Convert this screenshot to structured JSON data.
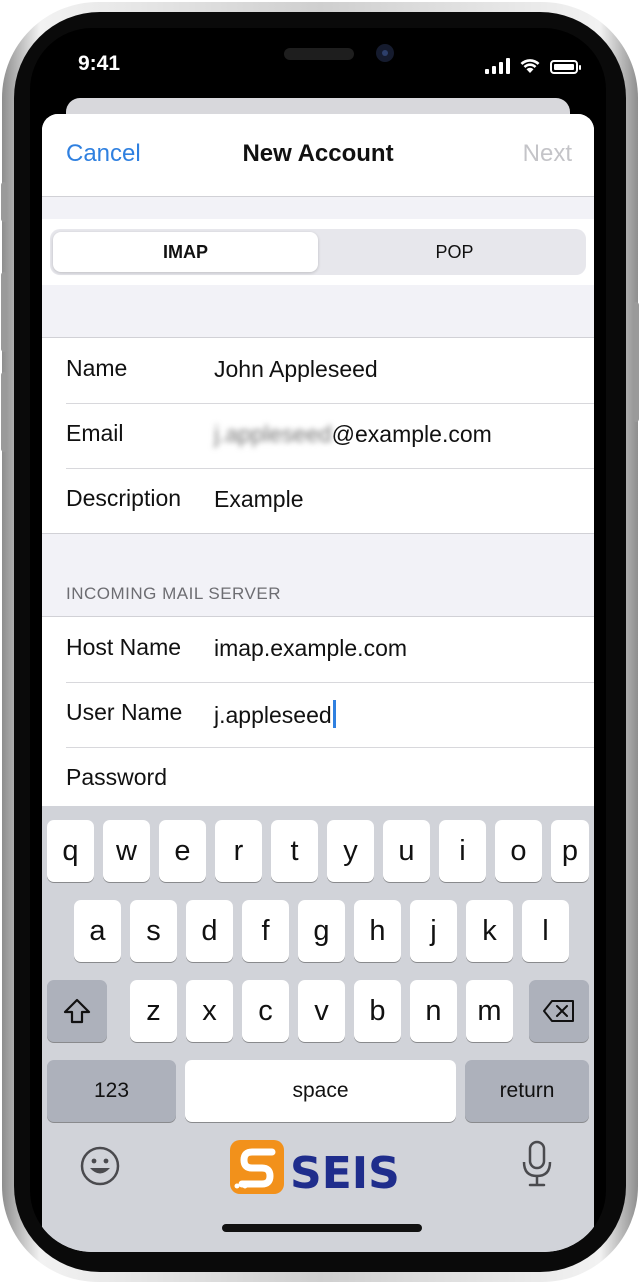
{
  "status_bar": {
    "time": "9:41"
  },
  "nav": {
    "cancel": "Cancel",
    "title": "New Account",
    "next": "Next"
  },
  "segment": {
    "options": [
      "IMAP",
      "POP"
    ],
    "selected": "IMAP"
  },
  "account": {
    "rows": [
      {
        "label": "Name",
        "value": "John Appleseed"
      },
      {
        "label": "Email",
        "value_blurred": "j.appleseed",
        "value_suffix": "@example.com"
      },
      {
        "label": "Description",
        "value": "Example"
      }
    ]
  },
  "incoming": {
    "header": "INCOMING MAIL SERVER",
    "rows": [
      {
        "label": "Host Name",
        "value": "imap.example.com"
      },
      {
        "label": "User Name",
        "value": "j.appleseed"
      },
      {
        "label": "Password",
        "value": ""
      }
    ]
  },
  "keyboard": {
    "row1": [
      "q",
      "w",
      "e",
      "r",
      "t",
      "y",
      "u",
      "i",
      "o",
      "p"
    ],
    "row2": [
      "a",
      "s",
      "d",
      "f",
      "g",
      "h",
      "j",
      "k",
      "l"
    ],
    "row3": [
      "z",
      "x",
      "c",
      "v",
      "b",
      "n",
      "m"
    ],
    "numbers": "123",
    "space": "space",
    "return": "return"
  },
  "logo": {
    "text": "SEIS",
    "colors": {
      "accent": "#f2911b",
      "text": "#1f2d8c"
    }
  },
  "colors": {
    "link": "#2f80e0",
    "disabled": "#c4c4c8"
  }
}
